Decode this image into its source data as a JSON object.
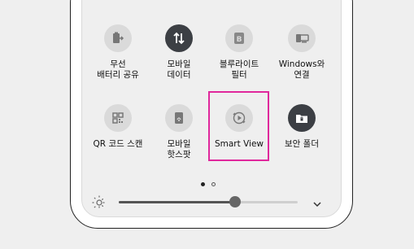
{
  "colors": {
    "page_bg": "#efefef",
    "tile_off_bg": "#dadada",
    "tile_on_bg": "#3c3f44",
    "highlight": "#e0289c"
  },
  "tiles": [
    {
      "label": "무선\n배터리 공유",
      "icon": "battery-share-icon",
      "state": "off"
    },
    {
      "label": "모바일\n데이터",
      "icon": "mobile-data-icon",
      "state": "on"
    },
    {
      "label": "블루라이트\n필터",
      "icon": "blue-light-filter-icon",
      "state": "off"
    },
    {
      "label": "Windows와\n연결",
      "icon": "link-to-windows-icon",
      "state": "off"
    },
    {
      "label": "QR 코드 스캔",
      "icon": "qr-code-icon",
      "state": "off"
    },
    {
      "label": "모바일\n핫스팟",
      "icon": "mobile-hotspot-icon",
      "state": "off"
    },
    {
      "label": "Smart View",
      "icon": "smart-view-icon",
      "state": "off",
      "highlighted": true
    },
    {
      "label": "보안 폴더",
      "icon": "secure-folder-icon",
      "state": "on"
    }
  ],
  "pagination": {
    "current_page": 1,
    "page_count": 2
  },
  "brightness": {
    "level": 0.65,
    "icon": "brightness-sun-icon",
    "expand_icon": "chevron-down-icon"
  }
}
